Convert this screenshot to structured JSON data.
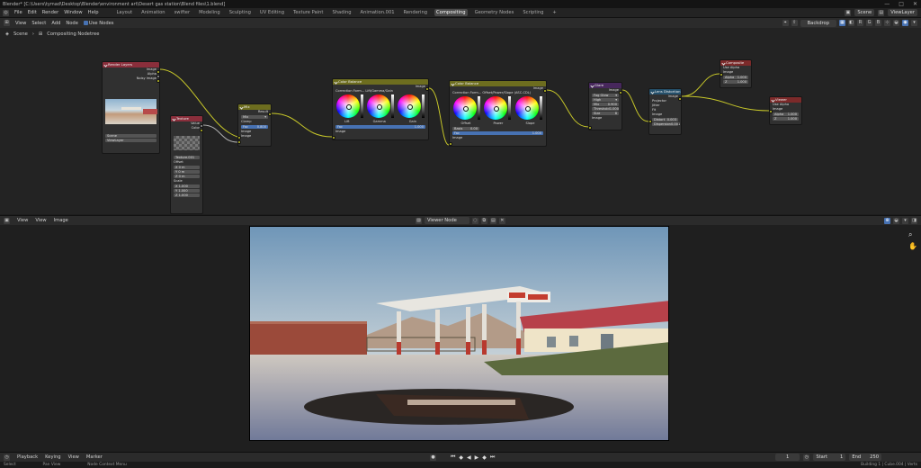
{
  "window": {
    "title": "Blender* [C:\\Users\\tymad\\Desktop\\Blender\\environment art\\Desert gas station\\Blend files\\1.blend]",
    "controls": [
      "—",
      "□",
      "✕"
    ]
  },
  "menubar": {
    "menus": [
      "File",
      "Edit",
      "Render",
      "Window",
      "Help"
    ],
    "workspaces": [
      "Layout",
      "Animation",
      "swifter",
      "Modeling",
      "Sculpting",
      "UV Editing",
      "Texture Paint",
      "Shading",
      "Animation.001",
      "Rendering",
      "Compositing",
      "Geometry Nodes",
      "Scripting"
    ],
    "active_workspace": "Compositing",
    "add_tab": "+",
    "scene_name": "Scene",
    "view_layer": "ViewLayer"
  },
  "node_header": {
    "menus": [
      "View",
      "Select",
      "Add",
      "Node"
    ],
    "use_nodes_label": "Use Nodes",
    "backdrop_label": "Backdrop"
  },
  "breadcrumb": [
    "Scene",
    "Compositing Nodetree"
  ],
  "nodes": {
    "render_layers": {
      "title": "Render Layers",
      "outputs": [
        "Image",
        "Alpha",
        "Noisy Image"
      ],
      "scene": "Scene",
      "layer": "ViewLayer"
    },
    "dilate": {
      "title": "Texture",
      "outputs": [
        "Value",
        "Color"
      ],
      "texture": "Texture.001",
      "offset_label": "Offset",
      "offset": [
        "X 0 m",
        "Y 0 m",
        "Z 0 m"
      ],
      "scale_label": "Scale",
      "scale": [
        "X 1.000",
        "Y 1.000",
        "Z 1.000"
      ]
    },
    "mix": {
      "title": "Mix",
      "output": "Result",
      "mode": "Mix",
      "clamp": "Clamp",
      "fac": "Fac",
      "fac_value": "0.800",
      "inputs": [
        "Image",
        "Image"
      ]
    },
    "color_balance_1": {
      "title": "Color Balance",
      "output": "Image",
      "method": "Lift/Gamma/Gain",
      "method_label": "Correction Form...",
      "wheels": [
        "Lift",
        "Gamma",
        "Gain"
      ],
      "fac": "Fac",
      "fac_value": "1.000",
      "input": "Image"
    },
    "color_balance_2": {
      "title": "Color Balance",
      "output": "Image",
      "method": "Offset/Power/Slope (ASC-CDL)",
      "method_label": "Correction Form...",
      "wheels": [
        "Offset",
        "Power",
        "Slope"
      ],
      "basis": "Basis",
      "basis_value": "0.00",
      "fac": "Fac",
      "fac_value": "1.000",
      "input": "Image"
    },
    "glare": {
      "title": "Glare",
      "output": "Image",
      "type": "Fog Glow",
      "quality": "High",
      "mix": "Mix",
      "mix_value": "0.900",
      "threshold": "Threshold",
      "threshold_value": "1.000",
      "size": "Size",
      "size_value": "8",
      "input": "Image"
    },
    "lens_distortion": {
      "title": "Lens Distortion",
      "output": "Image",
      "projector": "Projector",
      "jitter": "Jitter",
      "fit": "Fit",
      "input": "Image",
      "distort": "Distort",
      "distort_value": "0.003",
      "dispersion": "Dispersion",
      "dispersion_value": "0.001"
    },
    "composite": {
      "title": "Composite",
      "use_alpha": "Use Alpha",
      "inputs": [
        "Image",
        "Alpha",
        "Z"
      ],
      "alpha_value": "1.000",
      "z_value": "1.000"
    },
    "viewer": {
      "title": "Viewer",
      "use_alpha": "Use Alpha",
      "inputs": [
        "Image",
        "Alpha",
        "Z"
      ],
      "alpha_value": "1.000",
      "z_value": "1.000"
    }
  },
  "image_header": {
    "menus": [
      "View",
      "View",
      "Image"
    ],
    "image_name": "Viewer Node"
  },
  "timeline": {
    "menus": [
      "Playback",
      "Keying",
      "View",
      "Marker"
    ],
    "current_frame": "1",
    "start_label": "Start",
    "start": "1",
    "end_label": "End",
    "end": "250"
  },
  "statusbar": {
    "left": "Select",
    "mid": "Pan View",
    "mid2": "Node Context Menu",
    "right": "Building 1 | Cube.004 | Verts"
  },
  "colors": {
    "wire": "#c7c729",
    "node_render_layers": "#8a2e3b",
    "node_texture": "#8a2e3b",
    "node_color": "#6d6d1f",
    "node_filter": "#47275c",
    "node_distort": "#25506b",
    "node_output": "#7c2a2a"
  }
}
